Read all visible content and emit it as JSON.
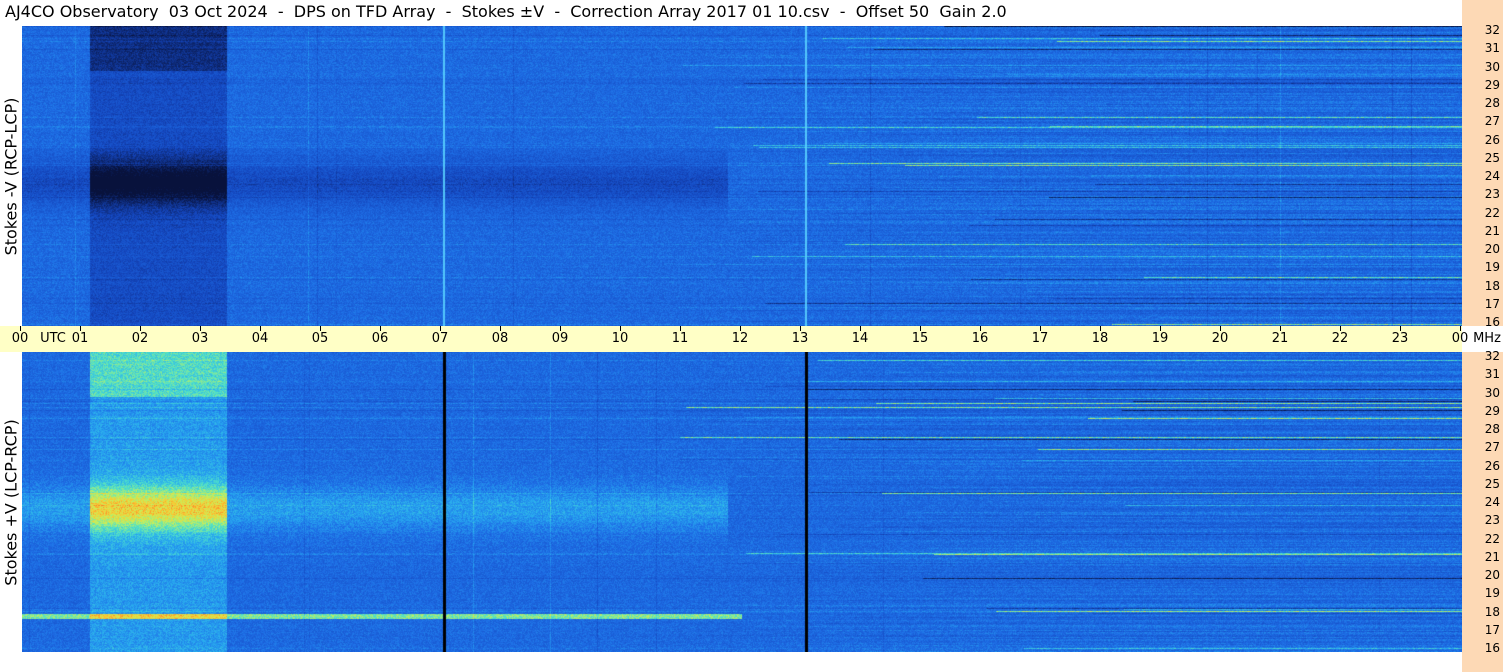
{
  "title": "AJ4CO Observatory  03 Oct 2024  -  DPS on TFD Array  -  Stokes ±V  -  Correction Array 2017 01 10.csv  -  Offset 50  Gain 2.0",
  "top_panel": {
    "label": "Stokes -V (RCP-LCP)"
  },
  "bottom_panel": {
    "label": "Stokes +V (LCP-RCP)"
  },
  "time_axis": {
    "unit_label": "UTC",
    "end_unit": "MHz",
    "hours": [
      "00",
      "01",
      "02",
      "03",
      "04",
      "05",
      "06",
      "07",
      "08",
      "09",
      "10",
      "11",
      "12",
      "13",
      "14",
      "15",
      "16",
      "17",
      "18",
      "19",
      "20",
      "21",
      "22",
      "23",
      "00"
    ]
  },
  "freq_axis": {
    "labels": [
      "32",
      "31",
      "30",
      "29",
      "28",
      "27",
      "26",
      "25",
      "24",
      "23",
      "22",
      "21",
      "20",
      "19",
      "18",
      "17",
      "16"
    ]
  },
  "colors": {
    "background_blue": "#1a5fd8",
    "freq_scale_bg": "#fdd9b5",
    "time_bar_bg": "#ffffc6"
  }
}
